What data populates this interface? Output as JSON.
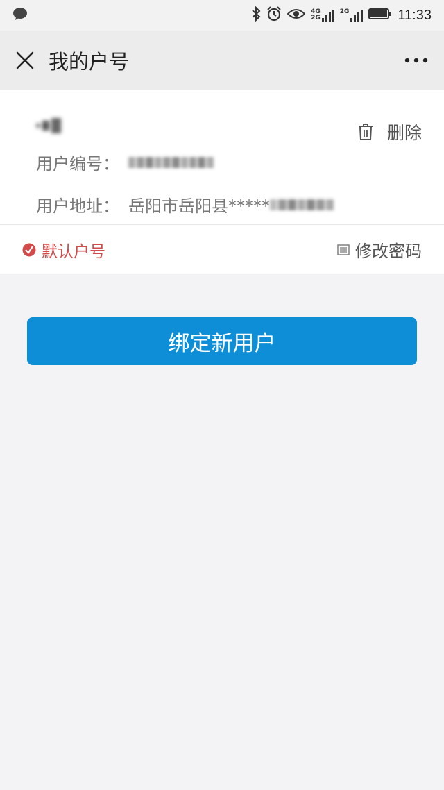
{
  "status_bar": {
    "time": "11:33",
    "network_1": [
      "4G",
      "2G"
    ],
    "network_2": "2G"
  },
  "header": {
    "title": "我的户号"
  },
  "account": {
    "delete_label": "删除",
    "id_label": "用户编号：",
    "address_label": "用户地址：",
    "address_value": "岳阳市岳阳县*****",
    "default_label": "默认户号",
    "change_password_label": "修改密码"
  },
  "bind_button_label": "绑定新用户",
  "colors": {
    "accent": "#0e8ed6",
    "default_tag": "#d24a4a",
    "background": "#f3f3f5"
  }
}
